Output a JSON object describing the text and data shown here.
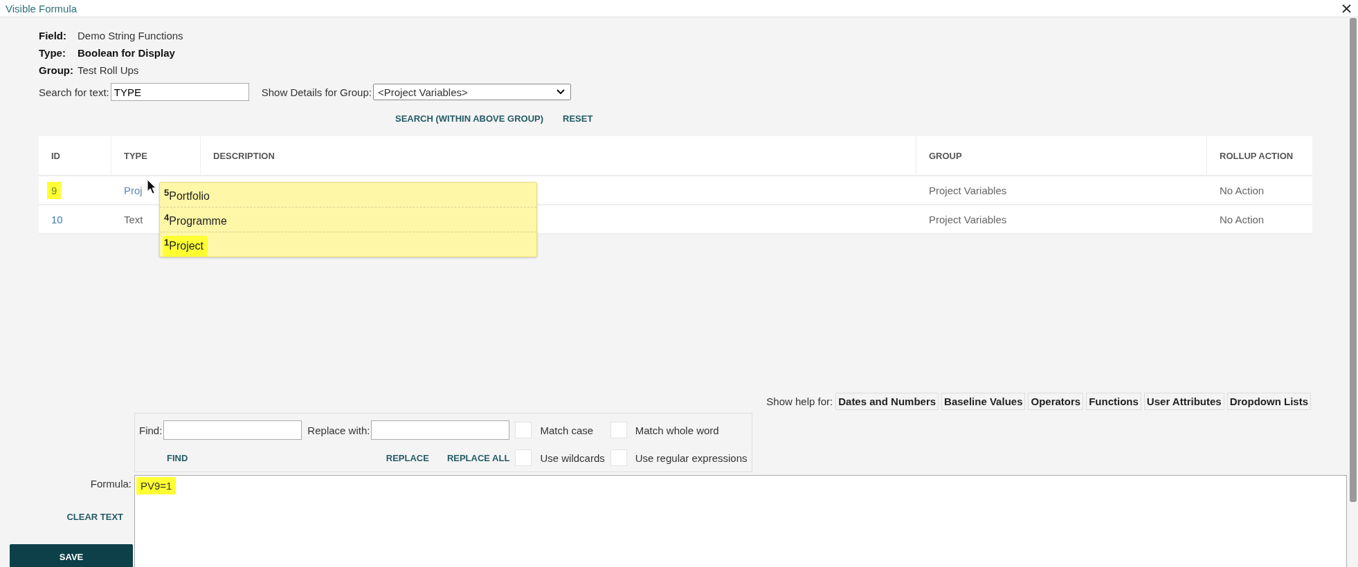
{
  "window": {
    "title": "Visible Formula"
  },
  "fields": [
    {
      "label": "Field:",
      "value": "Demo String Functions",
      "bold": false
    },
    {
      "label": "Type:",
      "value": "Boolean for Display",
      "bold": true
    },
    {
      "label": "Group:",
      "value": "Test Roll Ups",
      "bold": false
    }
  ],
  "search": {
    "label": "Search for text:",
    "value": "TYPE"
  },
  "group_select": {
    "label": "Show Details for Group:",
    "value": "<Project Variables>"
  },
  "search_links": [
    "SEARCH (WITHIN ABOVE GROUP)",
    "RESET"
  ],
  "table": {
    "columns": [
      "ID",
      "TYPE",
      "DESCRIPTION",
      "GROUP",
      "ROLLUP ACTION"
    ],
    "rows": [
      {
        "id": "9",
        "id_highlighted": true,
        "type": "Proj",
        "type_link": true,
        "group": "Project Variables",
        "rollup_action": "No Action"
      },
      {
        "id": "10",
        "id_highlighted": false,
        "type": "Text",
        "type_link": false,
        "group": "Project Variables",
        "rollup_action": "No Action"
      }
    ]
  },
  "dropdown_popup": {
    "items": [
      {
        "number": "5",
        "label": "Portfolio",
        "highlighted": false
      },
      {
        "number": "4",
        "label": "Programme",
        "highlighted": false
      },
      {
        "number": "1",
        "label": "Project",
        "highlighted": true
      }
    ]
  },
  "help": {
    "label": "Show help for:",
    "buttons": [
      "Dates and Numbers",
      "Baseline Values",
      "Operators",
      "Functions",
      "User Attributes",
      "Dropdown Lists"
    ]
  },
  "find_replace": {
    "find_label": "Find:",
    "replace_label": "Replace with:",
    "find_action": "FIND",
    "replace_actions": [
      "REPLACE",
      "REPLACE ALL"
    ],
    "options": [
      {
        "label": "Match case",
        "checked": false
      },
      {
        "label": "Match whole word",
        "checked": false
      },
      {
        "label": "Use wildcards",
        "checked": false
      },
      {
        "label": "Use regular expressions",
        "checked": false
      }
    ]
  },
  "formula": {
    "label": "Formula:",
    "value": "PV9=1",
    "highlighted": true
  },
  "clear_text": "CLEAR TEXT",
  "save": "SAVE"
}
